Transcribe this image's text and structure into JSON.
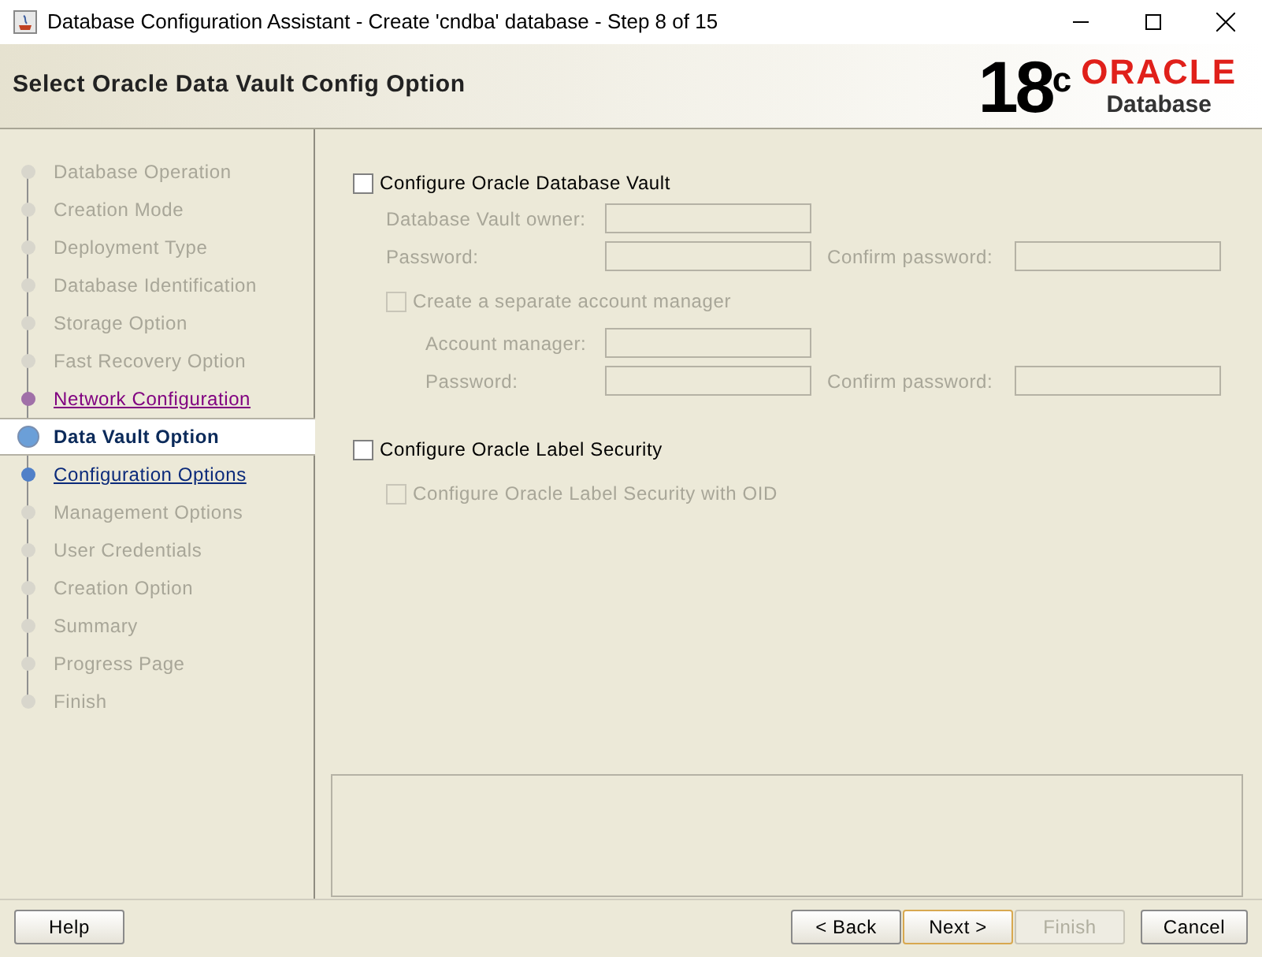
{
  "window": {
    "title": "Database Configuration Assistant - Create 'cndba' database - Step 8 of 15"
  },
  "header": {
    "title": "Select Oracle Data Vault Config Option",
    "logo": {
      "version": "18",
      "superscript": "c",
      "brand": "ORACLE",
      "product": "Database"
    }
  },
  "steps": [
    {
      "label": "Database Operation",
      "kind": "disabled",
      "selected": false
    },
    {
      "label": "Creation Mode",
      "kind": "disabled",
      "selected": false
    },
    {
      "label": "Deployment Type",
      "kind": "disabled",
      "selected": false
    },
    {
      "label": "Database Identification",
      "kind": "disabled",
      "selected": false
    },
    {
      "label": "Storage Option",
      "kind": "disabled",
      "selected": false
    },
    {
      "label": "Fast Recovery Option",
      "kind": "disabled",
      "selected": false
    },
    {
      "label": "Network Configuration",
      "kind": "visited",
      "selected": false
    },
    {
      "label": "Data Vault Option",
      "kind": "current",
      "selected": true
    },
    {
      "label": "Configuration Options",
      "kind": "link",
      "selected": false
    },
    {
      "label": "Management Options",
      "kind": "disabled",
      "selected": false
    },
    {
      "label": "User Credentials",
      "kind": "disabled",
      "selected": false
    },
    {
      "label": "Creation Option",
      "kind": "disabled",
      "selected": false
    },
    {
      "label": "Summary",
      "kind": "disabled",
      "selected": false
    },
    {
      "label": "Progress Page",
      "kind": "disabled",
      "selected": false
    },
    {
      "label": "Finish",
      "kind": "disabled",
      "selected": false
    }
  ],
  "vault": {
    "label": "Configure Oracle Database Vault",
    "checked": false,
    "disabled": false,
    "owner": {
      "label": "Database Vault owner:",
      "disabled": true
    },
    "password": {
      "label": "Password:",
      "disabled": true
    },
    "confirm": {
      "label": "Confirm password:",
      "disabled": true
    },
    "account_manager_option": {
      "label": "Create a separate account manager",
      "checked": false,
      "disabled": true
    },
    "account_manager": {
      "label": "Account manager:",
      "disabled": true
    },
    "am_password": {
      "label": "Password:",
      "disabled": true
    },
    "am_confirm": {
      "label": "Confirm password:",
      "disabled": true
    }
  },
  "label_security": {
    "label": "Configure Oracle Label Security",
    "checked": false,
    "disabled": false,
    "oid_option": {
      "label": "Configure Oracle Label Security with OID",
      "checked": false,
      "disabled": true
    }
  },
  "buttons": [
    {
      "label": "Help",
      "kind": "help",
      "disabled": false,
      "default": false
    },
    {
      "label": "< Back",
      "kind": "nav",
      "disabled": false,
      "default": false
    },
    {
      "label": "Next >",
      "kind": "nav",
      "disabled": false,
      "default": true
    },
    {
      "label": "Finish",
      "kind": "nav",
      "disabled": true,
      "default": false
    },
    {
      "label": "Cancel",
      "kind": "cancel",
      "disabled": false,
      "default": false
    }
  ]
}
